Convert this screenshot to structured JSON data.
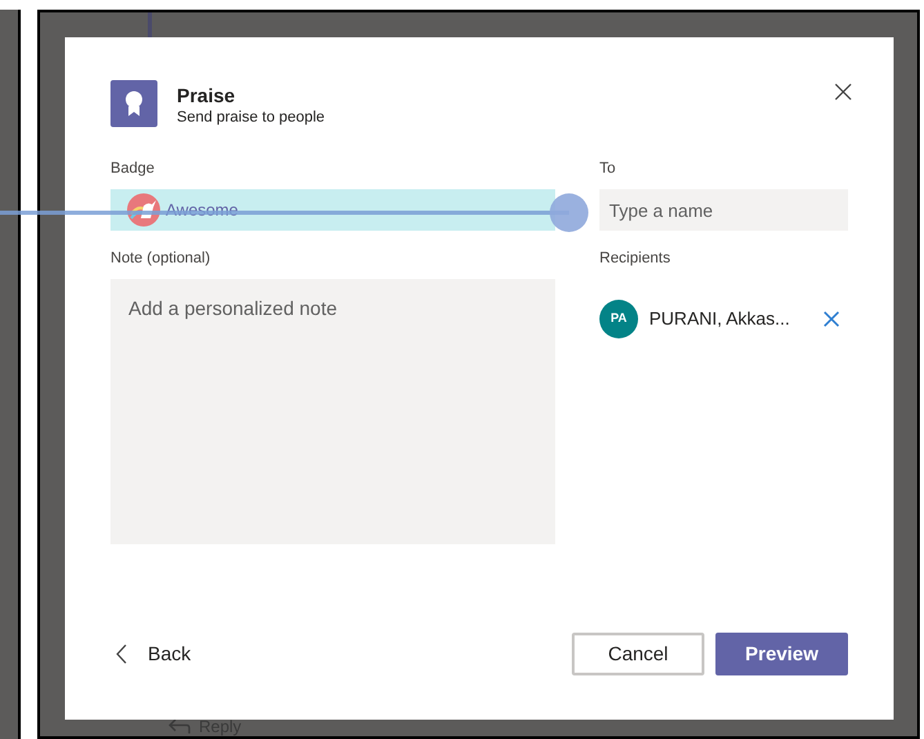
{
  "background": {
    "reply_label": "Reply"
  },
  "dialog": {
    "title": "Praise",
    "subtitle": "Send praise to people",
    "badge": {
      "label": "Badge",
      "value": "Awesome"
    },
    "to": {
      "label": "To",
      "placeholder": "Type a name"
    },
    "note": {
      "label": "Note (optional)",
      "placeholder": "Add a personalized note"
    },
    "recipients": {
      "label": "Recipients",
      "items": [
        {
          "initials": "PA",
          "name": "PURANI, Akkas..."
        }
      ]
    },
    "back_label": "Back",
    "buttons": [
      {
        "label": "Cancel",
        "kind": "secondary"
      },
      {
        "label": "Preview",
        "kind": "primary"
      }
    ]
  }
}
